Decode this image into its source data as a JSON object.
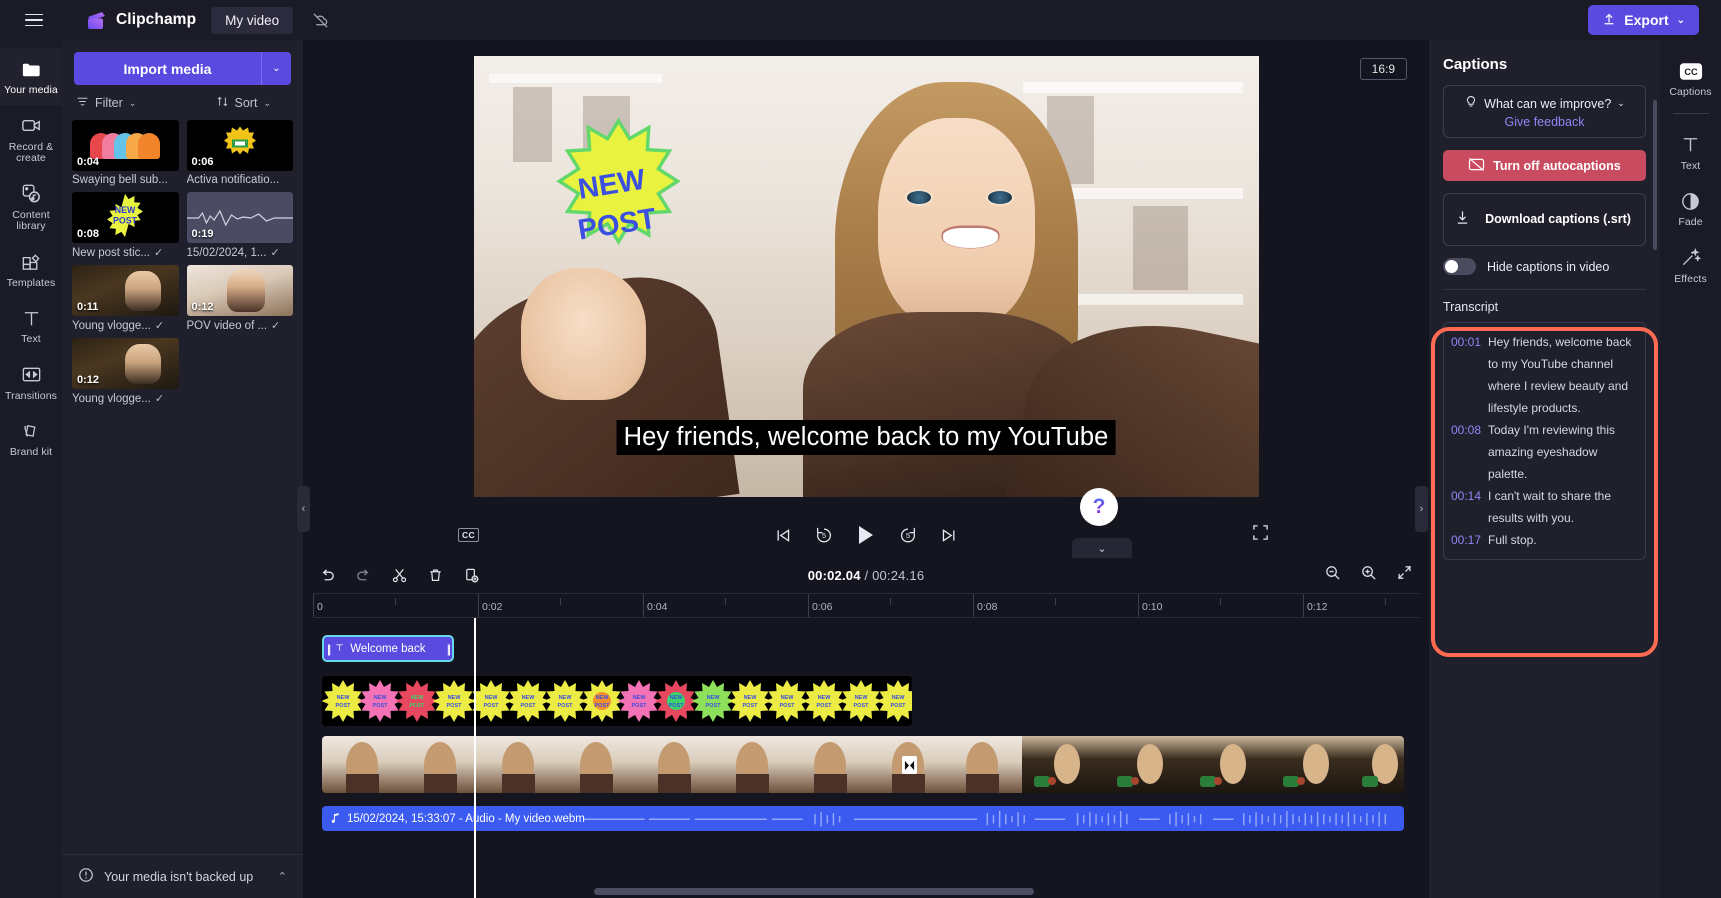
{
  "topbar": {
    "menu_icon": "hamburger-icon",
    "brand": "Clipchamp",
    "project_name": "My video",
    "cloud_icon": "cloud-off-icon",
    "export_label": "Export",
    "export_caret": "⌄"
  },
  "left_rail": {
    "items": [
      {
        "label": "Your media",
        "icon": "folder-icon",
        "active": true
      },
      {
        "label": "Record & create",
        "icon": "video-camera-icon",
        "active": false
      },
      {
        "label": "Content library",
        "icon": "content-library-icon",
        "active": false
      },
      {
        "label": "Templates",
        "icon": "templates-icon",
        "active": false
      },
      {
        "label": "Text",
        "icon": "text-t-icon",
        "active": false
      },
      {
        "label": "Transitions",
        "icon": "transitions-icon",
        "active": false
      },
      {
        "label": "Brand kit",
        "icon": "brand-kit-icon",
        "active": false
      }
    ]
  },
  "media_panel": {
    "import_label": "Import media",
    "import_caret": "⌄",
    "filter_label": "Filter",
    "filter_caret": "⌄",
    "sort_label": "Sort",
    "sort_caret": "⌄",
    "items": [
      {
        "duration": "0:04",
        "label": "Swaying bell sub...",
        "selected": false,
        "art": "bells"
      },
      {
        "duration": "0:06",
        "label": "Activa notificatio...",
        "selected": false,
        "art": "sticker-orange"
      },
      {
        "duration": "0:08",
        "label": "New post stic...",
        "selected": true,
        "art": "sticker-newpost"
      },
      {
        "duration": "0:19",
        "label": "15/02/2024, 1...",
        "selected": true,
        "art": "audio"
      },
      {
        "duration": "0:11",
        "label": "Young vlogge...",
        "selected": true,
        "art": "vlog-kitchen"
      },
      {
        "duration": "0:12",
        "label": "POV video of ...",
        "selected": true,
        "art": "vlog-pov"
      },
      {
        "duration": "0:12",
        "label": "Young vlogge...",
        "selected": true,
        "art": "vlog-kitchen"
      }
    ],
    "backup_notice": "Your media isn't backed up",
    "backup_icon": "alert-circle-icon",
    "backup_caret": "⌃"
  },
  "preview": {
    "aspect_ratio": "16:9",
    "caption_text": "Hey friends, welcome back to my YouTube",
    "sticker_line1": "NEW",
    "sticker_line2": "POST",
    "cc_button": "CC",
    "controls": [
      {
        "name": "skip-to-start-button",
        "glyph": "⏮"
      },
      {
        "name": "rewind-5s-button",
        "glyph": "5"
      },
      {
        "name": "play-button",
        "glyph": "▶"
      },
      {
        "name": "forward-5s-button",
        "glyph": "5"
      },
      {
        "name": "skip-to-end-button",
        "glyph": "⏭"
      }
    ],
    "fullscreen_icon": "fullscreen-icon"
  },
  "timeline": {
    "tools": [
      {
        "name": "undo-button",
        "icon": "undo-icon"
      },
      {
        "name": "redo-button",
        "icon": "redo-icon"
      },
      {
        "name": "split-button",
        "icon": "scissors-icon"
      },
      {
        "name": "delete-button",
        "icon": "trash-icon"
      },
      {
        "name": "duplicate-button",
        "icon": "duplicate-icon"
      }
    ],
    "current_time": "00:02.04",
    "separator": "/",
    "total_time": "00:24.16",
    "zoom_out_icon": "zoom-out-icon",
    "zoom_in_icon": "zoom-in-icon",
    "fit_icon": "fit-to-screen-icon",
    "ruler_labels": [
      "0",
      "0:02",
      "0:04",
      "0:06",
      "0:08",
      "0:10",
      "0:12"
    ],
    "text_clip_label": "Welcome back",
    "text_clip_icon": "text-t-icon",
    "sticker_clip_label": "NEW POST",
    "audio_clip_label": "15/02/2024, 15:33:07 - Audio - My video.webm",
    "audio_clip_icon": "music-note-icon",
    "playhead_position": "00:02.04"
  },
  "captions_panel": {
    "title": "Captions",
    "feedback_prompt": "What can we improve?",
    "feedback_icon": "lightbulb-icon",
    "feedback_caret": "⌄",
    "feedback_link": "Give feedback",
    "turn_off_label": "Turn off autocaptions",
    "turn_off_icon": "captions-off-icon",
    "download_label": "Download captions (.srt)",
    "download_icon": "download-icon",
    "hide_captions_label": "Hide captions in video",
    "hide_captions_on": false,
    "transcript_title": "Transcript",
    "transcript": [
      {
        "time": "00:01",
        "text": "Hey friends, welcome back to my YouTube channel where I review beauty and lifestyle products."
      },
      {
        "time": "00:08",
        "text": "Today I'm reviewing this amazing eyeshadow palette."
      },
      {
        "time": "00:14",
        "text": "I can't wait to share the results with you."
      },
      {
        "time": "00:17",
        "text": "Full stop."
      }
    ]
  },
  "right_rail": {
    "items": [
      {
        "label": "Captions",
        "icon": "cc-icon",
        "active": true
      },
      {
        "label": "Text",
        "icon": "text-t-icon",
        "active": false
      },
      {
        "label": "Fade",
        "icon": "fade-icon",
        "active": false
      },
      {
        "label": "Effects",
        "icon": "effects-wand-icon",
        "active": false
      }
    ]
  },
  "help": {
    "label": "?"
  },
  "colors": {
    "accent": "#5b4ae0",
    "danger": "#c94b5f",
    "highlight_ring": "#ff6b52",
    "audio_clip": "#3b5bf0",
    "selection": "#66d9e8"
  }
}
